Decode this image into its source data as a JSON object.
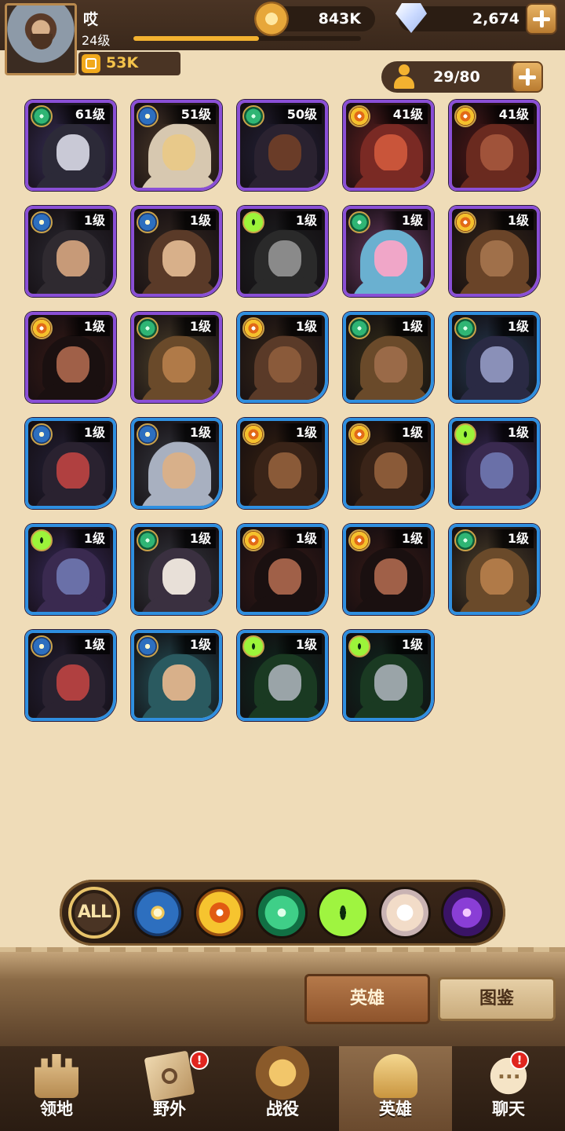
{
  "player": {
    "name": "哎",
    "level": "24级",
    "xp_progress": 0.55,
    "power": "53K"
  },
  "currency": {
    "gold": "843K",
    "gems": "2,674"
  },
  "roster": {
    "count": "29/80"
  },
  "heroes": [
    {
      "level": "61级",
      "faction": "wild",
      "rarity": "purple"
    },
    {
      "level": "51级",
      "faction": "light",
      "rarity": "purple"
    },
    {
      "level": "50级",
      "faction": "wild",
      "rarity": "purple"
    },
    {
      "level": "41级",
      "faction": "lava",
      "rarity": "purple"
    },
    {
      "level": "41级",
      "faction": "lava",
      "rarity": "purple"
    },
    {
      "level": "1级",
      "faction": "light",
      "rarity": "purple"
    },
    {
      "level": "1级",
      "faction": "light",
      "rarity": "purple"
    },
    {
      "level": "1级",
      "faction": "grave",
      "rarity": "purple"
    },
    {
      "level": "1级",
      "faction": "wild",
      "rarity": "purple"
    },
    {
      "level": "1级",
      "faction": "lava",
      "rarity": "purple"
    },
    {
      "level": "1级",
      "faction": "lava",
      "rarity": "purple"
    },
    {
      "level": "1级",
      "faction": "wild",
      "rarity": "purple"
    },
    {
      "level": "1级",
      "faction": "lava",
      "rarity": "blue"
    },
    {
      "level": "1级",
      "faction": "wild",
      "rarity": "blue"
    },
    {
      "level": "1级",
      "faction": "wild",
      "rarity": "blue"
    },
    {
      "level": "1级",
      "faction": "light",
      "rarity": "blue"
    },
    {
      "level": "1级",
      "faction": "light",
      "rarity": "blue"
    },
    {
      "level": "1级",
      "faction": "lava",
      "rarity": "blue"
    },
    {
      "level": "1级",
      "faction": "lava",
      "rarity": "blue"
    },
    {
      "level": "1级",
      "faction": "grave",
      "rarity": "blue"
    },
    {
      "level": "1级",
      "faction": "grave",
      "rarity": "blue"
    },
    {
      "level": "1级",
      "faction": "wild",
      "rarity": "blue"
    },
    {
      "level": "1级",
      "faction": "lava",
      "rarity": "blue"
    },
    {
      "level": "1级",
      "faction": "lava",
      "rarity": "blue"
    },
    {
      "level": "1级",
      "faction": "wild",
      "rarity": "blue"
    },
    {
      "level": "1级",
      "faction": "light",
      "rarity": "blue"
    },
    {
      "level": "1级",
      "faction": "light",
      "rarity": "blue"
    },
    {
      "level": "1级",
      "faction": "grave",
      "rarity": "blue"
    },
    {
      "level": "1级",
      "faction": "grave",
      "rarity": "blue"
    }
  ],
  "filters": {
    "all_label": "ALL",
    "icons": [
      "light-faction-icon",
      "lava-faction-icon",
      "wild-faction-icon",
      "grave-faction-icon",
      "celestial-faction-icon",
      "hypogean-faction-icon"
    ]
  },
  "tabs": {
    "heroes": "英雄",
    "codex": "图鉴"
  },
  "nav": {
    "items": [
      {
        "label": "领地",
        "icon": "castle-icon"
      },
      {
        "label": "野外",
        "icon": "map-icon",
        "alert": "!"
      },
      {
        "label": "战役",
        "icon": "battle-icon"
      },
      {
        "label": "英雄",
        "icon": "helmet-icon",
        "active": true
      },
      {
        "label": "聊天",
        "icon": "chat-icon",
        "alert": "!"
      }
    ]
  },
  "colors": {
    "background": "#efdcb8",
    "rarity_purple": "#8a4fd6",
    "rarity_blue": "#2f8fe0",
    "accent_gold": "#f3b230",
    "alert_red": "#e0251f"
  }
}
